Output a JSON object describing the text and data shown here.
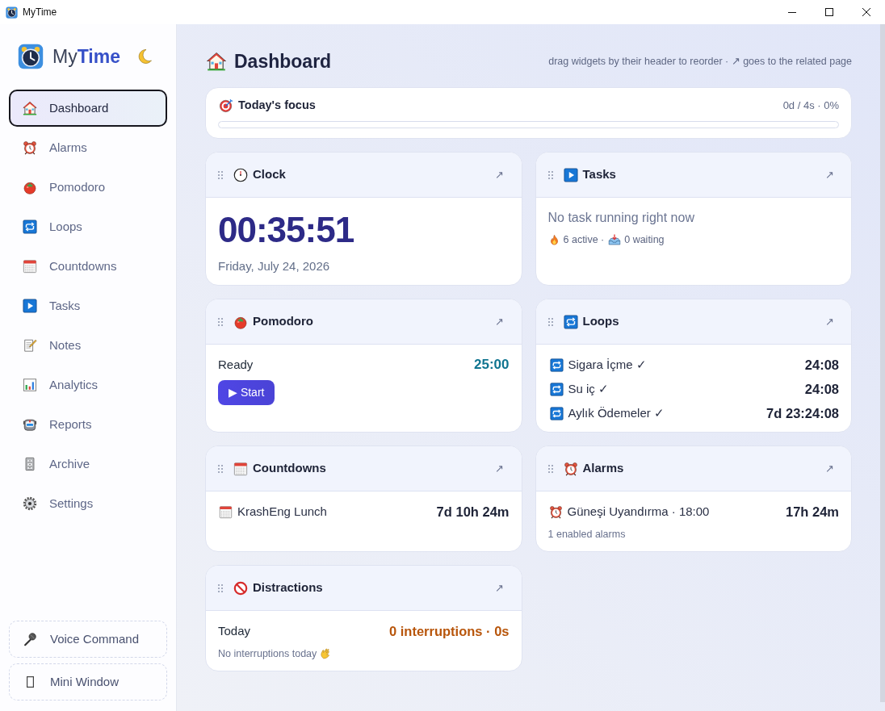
{
  "window": {
    "title": "MyTime"
  },
  "sidebar": {
    "logo": "My**Time**",
    "items": [
      {
        "label": "Dashboard",
        "selected": true
      },
      {
        "label": "Alarms",
        "selected": false
      },
      {
        "label": "Pomodoro",
        "selected": false
      },
      {
        "label": "Loops",
        "selected": false
      },
      {
        "label": "Countdowns",
        "selected": false
      },
      {
        "label": "Tasks",
        "selected": false
      },
      {
        "label": "Notes",
        "selected": false
      },
      {
        "label": "Analytics",
        "selected": false
      },
      {
        "label": "Reports",
        "selected": false
      },
      {
        "label": "Archive",
        "selected": false
      },
      {
        "label": "Settings",
        "selected": false
      }
    ],
    "bottom_buttons": [
      {
        "label": "Voice Command"
      },
      {
        "label": "Mini Window"
      }
    ]
  },
  "header": {
    "title": "Dashboard",
    "hint": "drag widgets by their header to reorder · ↗ goes to the related page"
  },
  "focus": {
    "title": "Today's focus",
    "summary": "0d / 4s · 0%"
  },
  "widgets": [
    {
      "kind": "clock",
      "title": "Clock",
      "open_link": "↗",
      "time": "00:35:51",
      "date": "Friday, July 24, 2026"
    },
    {
      "kind": "tasks",
      "title": "Tasks",
      "open_link": "↗",
      "status": "No task running right now",
      "active": "6 active ·",
      "waiting": "0 waiting"
    },
    {
      "kind": "pomodoro",
      "title": "Pomodoro",
      "open_link": "↗",
      "state": "Ready",
      "remaining": "25:00",
      "button": "▶ Start"
    },
    {
      "kind": "loops",
      "title": "Loops",
      "open_link": "↗",
      "rows": [
        {
          "name": "Sigara İçme ✓",
          "time": "24:08"
        },
        {
          "name": "Su iç ✓",
          "time": "24:08"
        },
        {
          "name": "Aylık Ödemeler ✓",
          "time": "7d 23:24:08"
        }
      ]
    },
    {
      "kind": "countdowns",
      "title": "Countdowns",
      "open_link": "↗",
      "rows": [
        {
          "name": "KrashEng Lunch",
          "time": "7d 10h 24m"
        }
      ]
    },
    {
      "kind": "alarms",
      "title": "Alarms",
      "open_link": "↗",
      "rows": [
        {
          "name": "Güneşi Uyandırma · 18:00",
          "time": "17h 24m"
        }
      ],
      "summary": "1 enabled alarms"
    },
    {
      "kind": "distractions",
      "title": "Distractions",
      "open_link": "↗",
      "label": "Today",
      "count": "0 interruptions · 0s",
      "note": "No interruptions today"
    }
  ]
}
